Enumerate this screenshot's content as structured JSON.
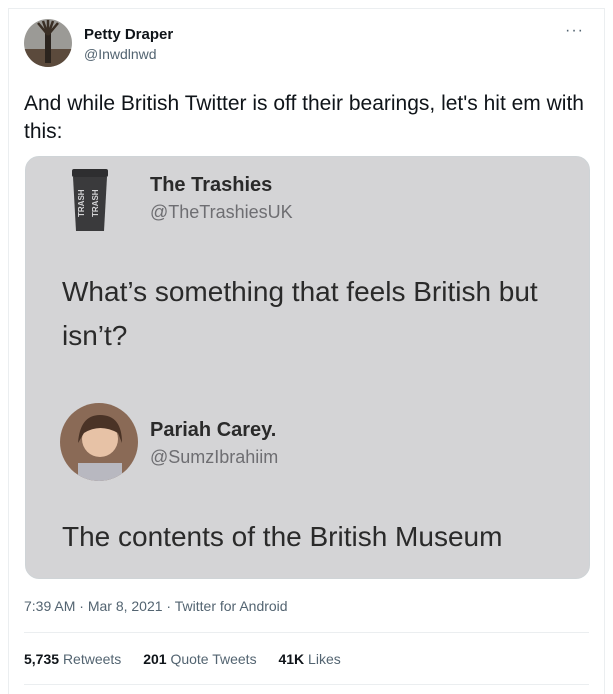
{
  "author": {
    "name": "Petty Draper",
    "handle": "@Inwdlnwd",
    "more_icon": "ellipsis-icon"
  },
  "tweet": {
    "text": "And while British Twitter is off their bearings,  let's hit em with this:"
  },
  "media": {
    "post1": {
      "name": "The Trashies",
      "handle": "@TheTrashiesUK",
      "text": "What’s something that feels British but isn’t?",
      "logo_text": "TRASH"
    },
    "post2": {
      "name": "Pariah Carey.",
      "handle": "@SumzIbrahiim",
      "text": "The contents of the British Museum"
    }
  },
  "meta": {
    "time": "7:39 AM",
    "sep1": " · ",
    "date": "Mar 8, 2021",
    "sep2": " · ",
    "source": "Twitter for Android"
  },
  "stats": {
    "retweets_count": "5,735",
    "retweets_label": "Retweets",
    "quotes_count": "201",
    "quotes_label": "Quote Tweets",
    "likes_count": "41K",
    "likes_label": "Likes"
  }
}
